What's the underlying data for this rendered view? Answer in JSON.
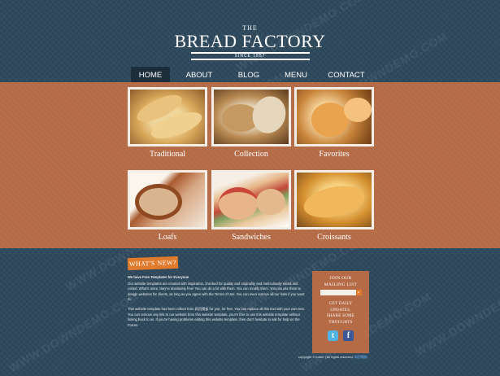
{
  "brand": {
    "the": "THE",
    "name": "BREAD FACTORY",
    "since": "SINCE 1857"
  },
  "nav": [
    {
      "label": "HOME",
      "active": true
    },
    {
      "label": "ABOUT",
      "active": false
    },
    {
      "label": "BLOG",
      "active": false
    },
    {
      "label": "MENU",
      "active": false
    },
    {
      "label": "CONTACT",
      "active": false
    }
  ],
  "products": [
    {
      "caption": "Traditional"
    },
    {
      "caption": "Collection"
    },
    {
      "caption": "Favorites"
    },
    {
      "caption": "Loafs"
    },
    {
      "caption": "Sandwiches"
    },
    {
      "caption": "Croissants"
    }
  ],
  "news": {
    "badge": "WHAT'S NEW?",
    "heading": "We have Free Templates for Everyone",
    "p1": "Our website templates are created with inspiration, checked for quality and originality and meticulously sliced and coded. What's more, they're absolutely free! You can do a lot with them. You can modify them. You can use them to design websites for clients, as long as you agree with the Terms of Use. You can even remove all our links if you want to.",
    "p2": "This website template has been collect from 网页模板 for you, for free. You can replace all this text with your own text. You can remove any link to our website from this website template, you're free to use this website template without linking back to us. If you're having problems editing this website template, then don't hesitate to ask for help on the Forum."
  },
  "sidebar": {
    "join": "JOIN OUR MAILING LIST",
    "go_label": "»",
    "updates": "GET DAILY UPDATES, SHARE SOME THOUGHTS",
    "icons": [
      "twitter-icon",
      "facebook-icon"
    ]
  },
  "footer": {
    "copyright": "copyright © footer | All rights reserved.",
    "link": "网页模板"
  },
  "watermark": "WWW.DOWNDEMO.COM",
  "colors": {
    "background": "#2f4a5e",
    "band": "#b46b46",
    "accent": "#e07a2c",
    "nav_active": "#1d2e3b"
  }
}
